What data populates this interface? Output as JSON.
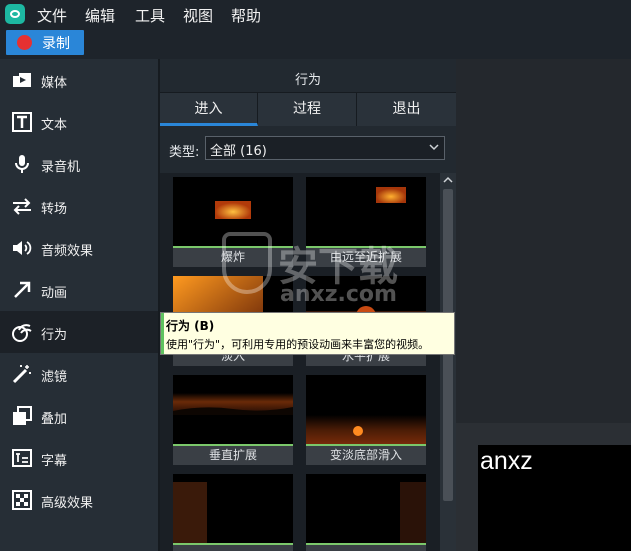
{
  "menu": [
    "文件",
    "编辑",
    "工具",
    "视图",
    "帮助"
  ],
  "record_button": "录制",
  "sidebar": [
    {
      "label": "媒体",
      "icon": "media-icon"
    },
    {
      "label": "文本",
      "icon": "text-icon"
    },
    {
      "label": "录音机",
      "icon": "microphone-icon"
    },
    {
      "label": "转场",
      "icon": "transition-icon"
    },
    {
      "label": "音频效果",
      "icon": "speaker-icon"
    },
    {
      "label": "动画",
      "icon": "arrow-icon"
    },
    {
      "label": "行为",
      "icon": "behavior-icon"
    },
    {
      "label": "滤镜",
      "icon": "magic-wand-icon"
    },
    {
      "label": "叠加",
      "icon": "overlay-icon"
    },
    {
      "label": "字幕",
      "icon": "caption-icon"
    },
    {
      "label": "高级效果",
      "icon": "advanced-effects-icon"
    }
  ],
  "panel": {
    "title": "行为",
    "tabs": [
      "进入",
      "过程",
      "退出"
    ],
    "active_tab": "进入",
    "type_label": "类型:",
    "type_value": "全部 (16)"
  },
  "thumbnails": [
    "爆炸",
    "由远至近扩展",
    "淡入",
    "水平扩展",
    "垂直扩展",
    "变淡底部滑入",
    "",
    ""
  ],
  "tooltip": {
    "title": "行为 (B)",
    "body": "使用\"行为\"，可利用专用的预设动画来丰富您的视频。"
  },
  "watermark": {
    "main": "安下载",
    "sub": "anxz.com"
  },
  "preview_text": "anxz",
  "colors": {
    "accent": "#2a86d8",
    "record": "#e63131",
    "thumb_line": "#7bc86b",
    "tooltip_bg": "#ffffe1"
  }
}
